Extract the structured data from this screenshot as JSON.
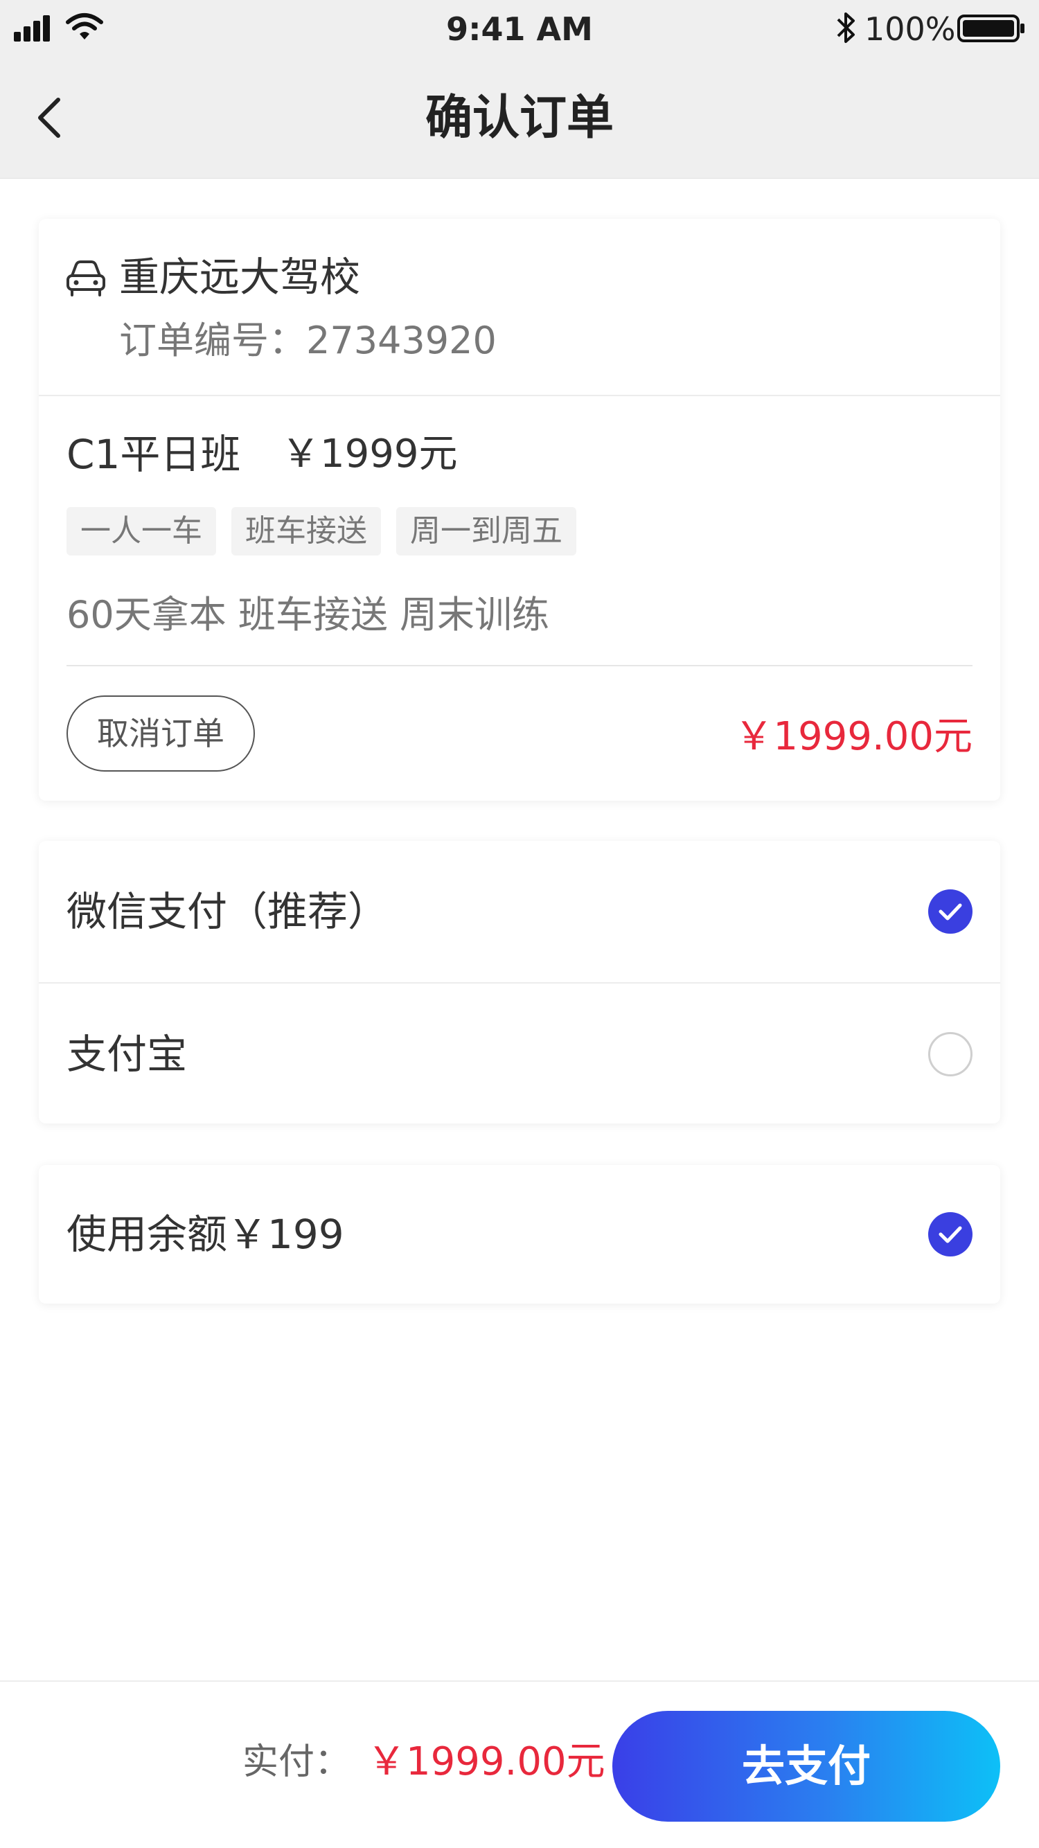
{
  "status_bar": {
    "time": "9:41 AM",
    "battery_percent": "100%",
    "icons": [
      "signal-icon",
      "wifi-icon",
      "bluetooth-icon",
      "battery-icon"
    ]
  },
  "nav": {
    "title": "确认订单",
    "back_icon": "chevron-left-icon"
  },
  "order": {
    "school_icon": "car-icon",
    "school_name": "重庆远大驾校",
    "order_number_text": "订单编号：27343920",
    "class_name": "C1平日班",
    "class_price": "￥1999元",
    "tags": [
      "一人一车",
      "班车接送",
      "周一到周五"
    ],
    "features": "60天拿本 班车接送 周末训练",
    "cancel_label": "取消订单",
    "total": "￥1999.00元"
  },
  "payment": {
    "methods": [
      {
        "label": "微信支付（推荐）",
        "selected": true
      },
      {
        "label": "支付宝",
        "selected": false
      }
    ]
  },
  "balance": {
    "label": "使用余额￥199",
    "selected": true
  },
  "footer": {
    "pay_prefix": "实付：",
    "pay_amount": "￥1999.00元",
    "submit_label": "去支付"
  },
  "colors": {
    "accent": "#3a3fe0",
    "price_red": "#e8283c",
    "gradient_start": "#3a3fe8",
    "gradient_end": "#0dc0f7"
  }
}
